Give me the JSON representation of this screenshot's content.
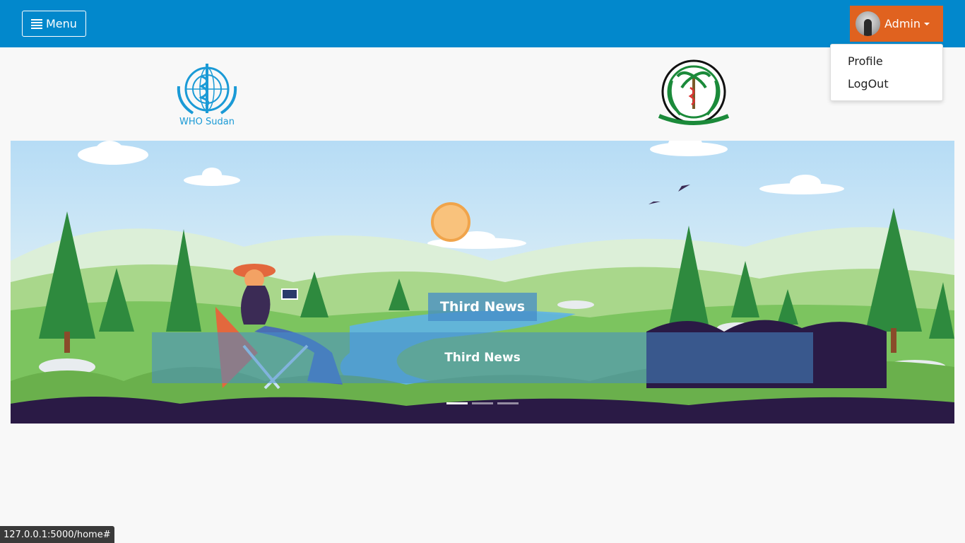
{
  "topbar": {
    "menu_label": "Menu",
    "user_label": "Admin",
    "colors": {
      "bar": "#0288cc",
      "user_button": "#e0621f"
    }
  },
  "user_menu": {
    "items": [
      {
        "label": "Profile"
      },
      {
        "label": "LogOut"
      }
    ]
  },
  "logos": {
    "who": {
      "caption": "WHO Sudan"
    }
  },
  "carousel": {
    "caption_title": "Third News",
    "caption_body": "Third News",
    "slide_count": 3,
    "active_slide": 1
  },
  "status_url": "127.0.0.1:5000/home#"
}
